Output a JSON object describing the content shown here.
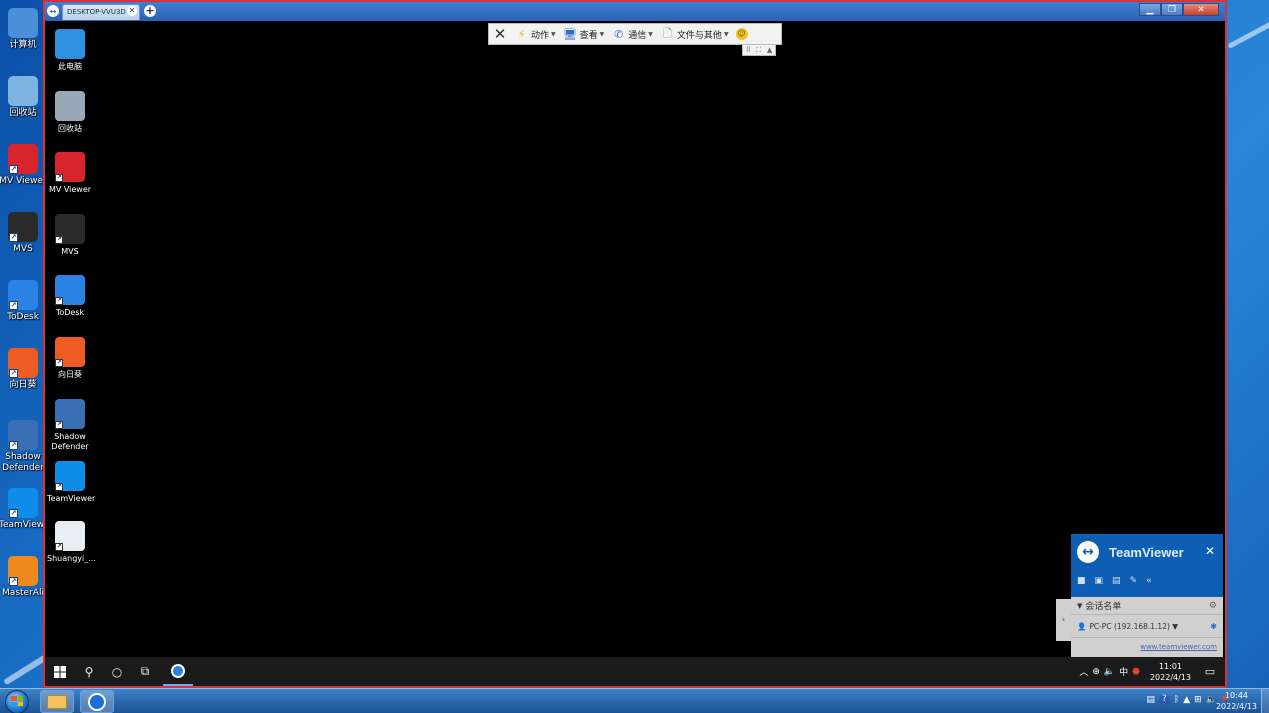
{
  "host": {
    "desktop_icons": [
      {
        "name": "computer",
        "label": "计算机",
        "icon": "computer-icon",
        "color": "#4a8fd8"
      },
      {
        "name": "recycle-bin",
        "label": "回收站",
        "icon": "recycle-bin-icon",
        "color": "#7fb3e0"
      },
      {
        "name": "mv-viewer",
        "label": "MV Viewer",
        "icon": "mv-viewer-icon",
        "color": "#d8242c"
      },
      {
        "name": "mvs",
        "label": "MVS",
        "icon": "mvs-icon",
        "color": "#2a2a2a"
      },
      {
        "name": "todesk",
        "label": "ToDesk",
        "icon": "todesk-icon",
        "color": "#2a82e4"
      },
      {
        "name": "sunlogin",
        "label": "向日葵",
        "icon": "sunlogin-icon",
        "color": "#f05a23"
      },
      {
        "name": "shadow-defender",
        "label": "Shadow Defender",
        "icon": "shadow-defender-icon",
        "color": "#3a6fb5"
      },
      {
        "name": "teamviewer",
        "label": "TeamViewer",
        "icon": "teamviewer-icon",
        "color": "#0e8ee9"
      },
      {
        "name": "masterali",
        "label": "MasterAli",
        "icon": "masterali-icon",
        "color": "#f08a1c"
      }
    ],
    "taskbar": {
      "clock_time": "10:44",
      "clock_date": "2022/4/13"
    }
  },
  "remote_window": {
    "tab_title": "DESKTOP-VVU3D",
    "tab_close": "✕",
    "tab_add": "+",
    "toolbar": {
      "close": "✕",
      "items": [
        {
          "label": "动作",
          "icon": "lightning-icon"
        },
        {
          "label": "查看",
          "icon": "monitor-icon"
        },
        {
          "label": "通信",
          "icon": "phone-icon"
        },
        {
          "label": "文件与其他",
          "icon": "file-icon"
        }
      ],
      "smile": "☺"
    },
    "desktop_icons": [
      {
        "name": "this-pc",
        "label": "此电脑",
        "icon": "this-pc-icon",
        "color": "#2f8fe0"
      },
      {
        "name": "recycle-bin",
        "label": "回收站",
        "icon": "recycle-bin-icon",
        "color": "#9aa9b8"
      },
      {
        "name": "mv-viewer",
        "label": "MV Viewer",
        "icon": "mv-viewer-icon",
        "color": "#d8242c"
      },
      {
        "name": "mvs",
        "label": "MVS",
        "icon": "mvs-icon",
        "color": "#2a2a2a"
      },
      {
        "name": "todesk",
        "label": "ToDesk",
        "icon": "todesk-icon",
        "color": "#2a82e4"
      },
      {
        "name": "sunlogin",
        "label": "向日葵",
        "icon": "sunlogin-icon",
        "color": "#f05a23"
      },
      {
        "name": "shadow-defender",
        "label": "Shadow Defender",
        "icon": "shadow-defender-icon",
        "color": "#3a6fb5"
      },
      {
        "name": "teamviewer",
        "label": "TeamViewer",
        "icon": "teamviewer-icon",
        "color": "#0e8ee9"
      },
      {
        "name": "shuangyi",
        "label": "Shuangyi_...",
        "icon": "shuangyi-icon",
        "color": "#e8eef4"
      }
    ],
    "teamviewer_panel": {
      "title": "TeamViewer",
      "close": "✕",
      "session_header": "会话名单",
      "session_item": "PC-PC (192.168.1.12) ▼",
      "link": "www.teamviewer.com"
    },
    "taskbar": {
      "clock_time": "11:01",
      "clock_date": "2022/4/13",
      "ime": "中"
    }
  }
}
